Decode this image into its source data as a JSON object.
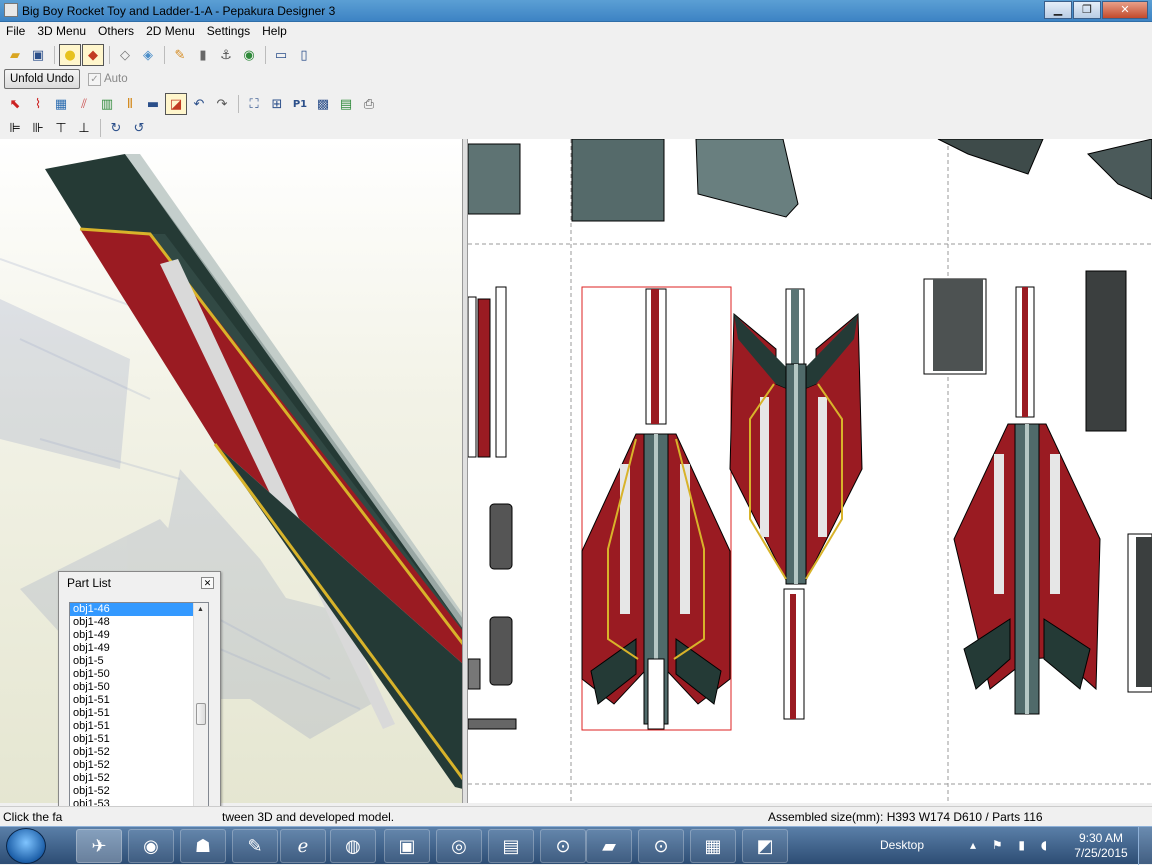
{
  "window": {
    "title": "Big Boy Rocket Toy and Ladder-1-A - Pepakura Designer 3",
    "buttons": [
      "▁",
      "❐",
      "✕"
    ]
  },
  "menu": [
    "File",
    "3D Menu",
    "Others",
    "2D Menu",
    "Settings",
    "Help"
  ],
  "toolbar1": {
    "icons": [
      "open-folder-icon",
      "save-icon",
      "lightbulb-icon",
      "textured-cube-icon",
      "cube-outline-icon",
      "cube-flat-icon",
      "pencil-icon",
      "cylinder-icon",
      "anchor-icon",
      "paint-bucket-icon",
      "single-pane-icon",
      "dual-pane-icon"
    ]
  },
  "toolbar2": {
    "unfold_undo": "Unfold Undo",
    "auto_label": "Auto",
    "auto_checked": true
  },
  "toolbar3": {
    "icons": [
      "select-arrow-icon",
      "edge-edit-icon",
      "part-icon",
      "flaps-icon",
      "join-icon",
      "rotate-part-icon",
      "image-icon",
      "layout-icon",
      "undo-icon",
      "redo-icon",
      "fit-icon",
      "zoom-icon",
      "page-p1-icon",
      "grid-icon",
      "print-preview-icon",
      "printer-icon"
    ]
  },
  "toolbar4": {
    "icons": [
      "align-left-icon",
      "align-right-icon",
      "align-top-icon",
      "align-bottom-icon",
      "rotate-90-icon",
      "rotate-minus-90-icon"
    ]
  },
  "partlist": {
    "title": "Part List",
    "items": [
      "obj1-46",
      "obj1-48",
      "obj1-49",
      "obj1-49",
      "obj1-5",
      "obj1-50",
      "obj1-50",
      "obj1-51",
      "obj1-51",
      "obj1-51",
      "obj1-51",
      "obj1-52",
      "obj1-52",
      "obj1-52",
      "obj1-52",
      "obj1-53",
      "obj1-53"
    ],
    "selected_index": 0
  },
  "status": {
    "left": "Click the fa",
    "left_rest": "tween 3D and developed model.",
    "right": "Assembled size(mm): H393 W174 D610 / Parts 116"
  },
  "taskbar": {
    "desktop": "Desktop",
    "time": "9:30 AM",
    "date": "7/25/2015",
    "apps": [
      "pepakura-icon",
      "eye-app-icon",
      "panther-icon",
      "paint-app-icon",
      "ie-icon",
      "firefox-icon",
      "game-icon",
      "chrome-icon",
      "terminal-icon",
      "lock-app-icon",
      "folder-icon",
      "lock-app-icon-2",
      "winrar-icon",
      "office-icon"
    ]
  },
  "colors": {
    "titlebar": "#4a90cf",
    "selection": "#3399ff",
    "rocket_red": "#9a1b22",
    "rocket_dark": "#243a36"
  }
}
